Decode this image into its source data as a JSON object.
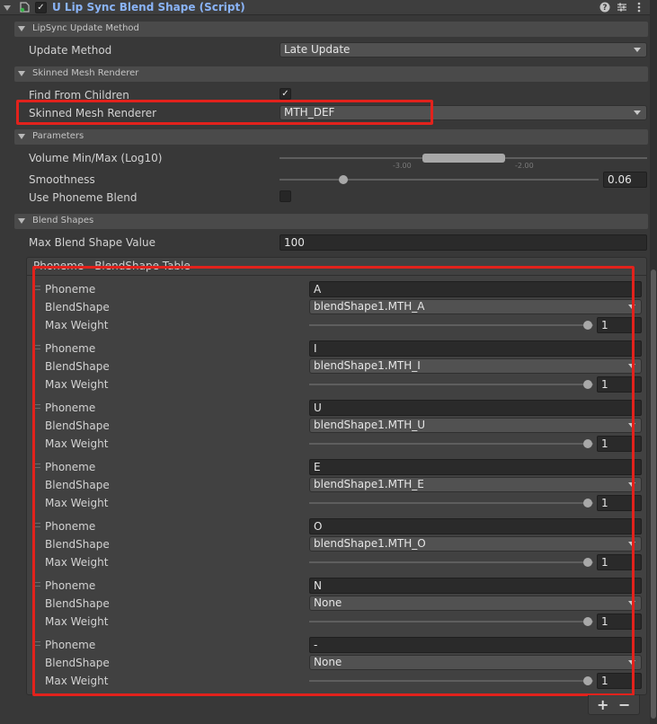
{
  "component": {
    "title": "U Lip Sync Blend Shape (Script)",
    "enabled_mark": "✓",
    "icons": [
      "help-icon",
      "preset-icon",
      "more-icon"
    ]
  },
  "sections": {
    "update": "LipSync Update Method",
    "smr": "Skinned Mesh Renderer",
    "params": "Parameters",
    "blend": "Blend Shapes"
  },
  "fields": {
    "update_method_label": "Update Method",
    "update_method_value": "Late Update",
    "find_children_label": "Find From Children",
    "find_children_checked": "✓",
    "smr_label": "Skinned Mesh Renderer",
    "smr_value": "MTH_DEF",
    "volume_label": "Volume Min/Max (Log10)",
    "volume_min_tick": "-3.00",
    "volume_max_tick": "-2.00",
    "smoothness_label": "Smoothness",
    "smoothness_value": "0.06",
    "smoothness_fraction": 0.2,
    "use_phoneme_label": "Use Phoneme Blend",
    "max_blend_label": "Max Blend Shape Value",
    "max_blend_value": "100"
  },
  "table": {
    "header": "Phoneme - BlendShape Table",
    "phoneme_label": "Phoneme",
    "blendshape_label": "BlendShape",
    "maxweight_label": "Max Weight",
    "rows": [
      {
        "phoneme": "A",
        "blendshape": "blendShape1.MTH_A",
        "max_weight": "1"
      },
      {
        "phoneme": "I",
        "blendshape": "blendShape1.MTH_I",
        "max_weight": "1"
      },
      {
        "phoneme": "U",
        "blendshape": "blendShape1.MTH_U",
        "max_weight": "1"
      },
      {
        "phoneme": "E",
        "blendshape": "blendShape1.MTH_E",
        "max_weight": "1"
      },
      {
        "phoneme": "O",
        "blendshape": "blendShape1.MTH_O",
        "max_weight": "1"
      },
      {
        "phoneme": "N",
        "blendshape": "None",
        "max_weight": "1"
      },
      {
        "phoneme": "-",
        "blendshape": "None",
        "max_weight": "1"
      }
    ],
    "add_label": "+",
    "remove_label": "−"
  },
  "colors": {
    "highlight": "#e2221c",
    "title_blue": "#8ab4f8"
  }
}
